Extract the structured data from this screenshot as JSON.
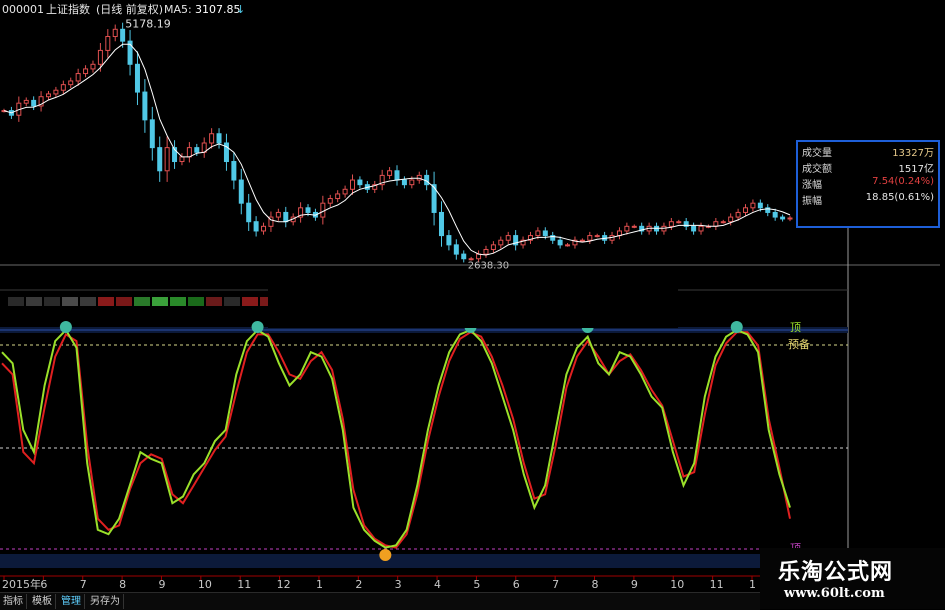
{
  "header": {
    "code": "000001",
    "name": "上证指数",
    "period": "(日线 前复权)",
    "ma_label": "MA5:",
    "ma_value": "3107.85",
    "arrow": "↓"
  },
  "info_panel": {
    "rows": [
      {
        "label": "成交量",
        "value": "13327万",
        "color": "#e6c98a"
      },
      {
        "label": "成交额",
        "value": "1517亿",
        "color": "#e6e6e6"
      },
      {
        "label": "涨幅",
        "value": "7.54(0.24%)",
        "color": "#e04040"
      },
      {
        "label": "振幅",
        "value": "18.85(0.61%)",
        "color": "#e6e6e6"
      }
    ]
  },
  "indicator": {
    "top_label": "顶",
    "ready_label": "预备",
    "bottom_label": "顶"
  },
  "colors": {
    "up_candle": "#e05050",
    "down_candle": "#50c8e6",
    "ma_line": "#ffffff",
    "fast_line": "#9be02a",
    "slow_line": "#e02020",
    "top_marker": "#3fb8a0",
    "bottom_marker": "#f0a020"
  },
  "x_axis_labels": [
    "2015年",
    "6",
    "7",
    "8",
    "9",
    "10",
    "11",
    "12",
    "1",
    "2",
    "3",
    "4",
    "5",
    "6",
    "7",
    "8",
    "9",
    "10",
    "11",
    "1"
  ],
  "tabs": [
    "指标",
    "模板",
    "管理",
    "另存为"
  ],
  "watermark": {
    "title": "乐淘公式网",
    "url": "www.60lt.com"
  },
  "chart_data": [
    {
      "type": "candlestick",
      "title": "",
      "series": [
        {
          "name": "上证指数"
        }
      ],
      "annotations": [
        {
          "text": "5178.19",
          "kind": "high"
        },
        {
          "text": "2638.30",
          "kind": "low"
        }
      ],
      "x": "trading days 2015-05 to 2017-01",
      "close_trace": [
        4300,
        4250,
        4380,
        4410,
        4350,
        4450,
        4480,
        4520,
        4580,
        4620,
        4700,
        4750,
        4800,
        4950,
        5100,
        5178,
        5050,
        4800,
        4500,
        4200,
        3900,
        3650,
        3900,
        3750,
        3800,
        3900,
        3850,
        3950,
        4050,
        3950,
        3750,
        3550,
        3300,
        3100,
        3000,
        3050,
        3150,
        3200,
        3100,
        3150,
        3250,
        3200,
        3150,
        3300,
        3350,
        3400,
        3450,
        3550,
        3500,
        3450,
        3500,
        3600,
        3650,
        3550,
        3500,
        3550,
        3600,
        3500,
        3200,
        2950,
        2850,
        2750,
        2700,
        2700,
        2750,
        2800,
        2850,
        2900,
        2950,
        2850,
        2900,
        2950,
        3000,
        2950,
        2900,
        2850,
        2850,
        2900,
        2900,
        2950,
        2950,
        2900,
        2950,
        3000,
        3050,
        3050,
        3000,
        3050,
        3000,
        3050,
        3100,
        3100,
        3050,
        3000,
        3050,
        3050,
        3100,
        3100,
        3150,
        3200,
        3250,
        3300,
        3250,
        3200,
        3150,
        3130,
        3140
      ],
      "ma5_last": 3107.85,
      "ylim": [
        2600,
        5300
      ]
    },
    {
      "type": "line",
      "title": "",
      "series": [
        {
          "name": "fast",
          "color": "#9be02a",
          "values": [
            90,
            85,
            55,
            45,
            75,
            95,
            100,
            92,
            40,
            10,
            8,
            15,
            30,
            45,
            42,
            40,
            22,
            25,
            35,
            40,
            50,
            55,
            80,
            95,
            100,
            97,
            85,
            75,
            80,
            90,
            88,
            78,
            55,
            20,
            10,
            5,
            2,
            3,
            10,
            30,
            55,
            75,
            90,
            98,
            100,
            95,
            85,
            70,
            55,
            35,
            20,
            30,
            55,
            80,
            92,
            97,
            85,
            80,
            90,
            88,
            80,
            70,
            65,
            45,
            30,
            40,
            70,
            88,
            97,
            100,
            98,
            90,
            55,
            35,
            20
          ],
          "line_note": "indicator oscillator 0-100"
        },
        {
          "name": "slow",
          "color": "#e02020",
          "values": [
            85,
            80,
            45,
            40,
            65,
            88,
            98,
            95,
            48,
            15,
            10,
            12,
            28,
            40,
            44,
            42,
            26,
            22,
            30,
            38,
            46,
            52,
            72,
            90,
            98,
            98,
            90,
            80,
            78,
            86,
            90,
            82,
            60,
            28,
            12,
            6,
            3,
            2,
            8,
            26,
            50,
            70,
            86,
            96,
            99,
            97,
            88,
            75,
            60,
            40,
            24,
            26,
            48,
            74,
            88,
            95,
            88,
            80,
            86,
            89,
            82,
            73,
            66,
            50,
            34,
            36,
            62,
            84,
            94,
            99,
            99,
            93,
            60,
            38,
            15
          ]
        }
      ],
      "thresholds": [
        {
          "label": "顶",
          "value": 100
        },
        {
          "label": "预备",
          "value": 92
        },
        {
          "label": "",
          "value": 50
        },
        {
          "label": "顶",
          "value": 0
        }
      ],
      "ylim": [
        0,
        100
      ]
    }
  ]
}
